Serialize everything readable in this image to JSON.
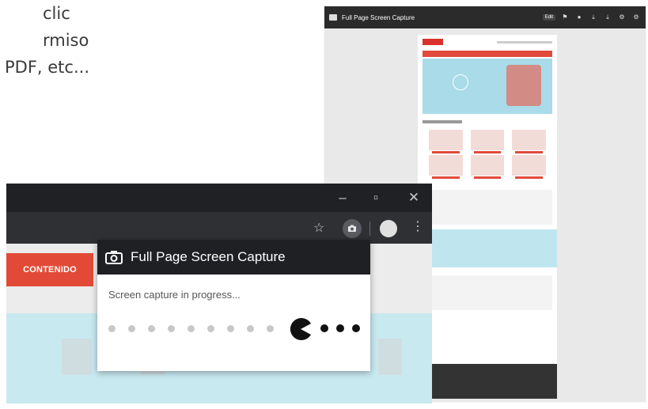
{
  "background_text": {
    "line1": "clic",
    "line2": "rmiso",
    "line3": "PDF, etc..."
  },
  "right_preview": {
    "title": "Full Page Screen Capture",
    "pill": "Edit"
  },
  "browser": {
    "window_controls": {
      "minimize": "–",
      "maximize": "▫",
      "close": "✕"
    },
    "page_button_label": "CONTENIDO",
    "popup": {
      "title": "Full Page Screen Capture",
      "status": "Screen capture in progress..."
    }
  },
  "colors": {
    "accent_red": "#e24a37",
    "dark_bar": "#1f2023",
    "cyan": "#c8e9f0"
  }
}
